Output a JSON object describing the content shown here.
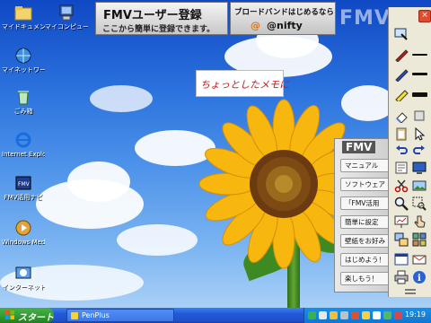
{
  "desktop_icons": [
    {
      "label": "マイドキュメント"
    },
    {
      "label": "マイコンピュータ"
    },
    {
      "label": "マイネットワーク"
    },
    {
      "label": "ごみ箱"
    },
    {
      "label": "Internet Explorer"
    },
    {
      "label": "FMV活用ナビ"
    },
    {
      "label": "Windows Media Player"
    },
    {
      "label": "インターネット初期設定"
    }
  ],
  "banner_fmv": {
    "title": "FMVユーザー登録",
    "subtitle": "ここから簡単に登録できます。"
  },
  "banner_nifty": {
    "title": "ブロードバンドはじめるなら",
    "brand": "@nifty",
    "logo": "@"
  },
  "fmv_ghost_logo": "FMV",
  "sticky_note": {
    "text": "ちょっとしたメモに"
  },
  "fmv_menu": {
    "header": "FMV",
    "items": [
      "マニュアル",
      "ソフトウェア",
      "「FMV活用",
      "簡単に設定",
      "壁紙をお好み",
      "はじめよう！",
      "楽しもう！"
    ]
  },
  "toolbar": {
    "close_label": "×"
  },
  "taskbar": {
    "start_label": "スタート",
    "task_label": "PenPlus",
    "clock": "19:19"
  },
  "colors": {
    "note_text": "#d0121b",
    "taskbar": "#2458d6",
    "start": "#2f9a2f"
  }
}
